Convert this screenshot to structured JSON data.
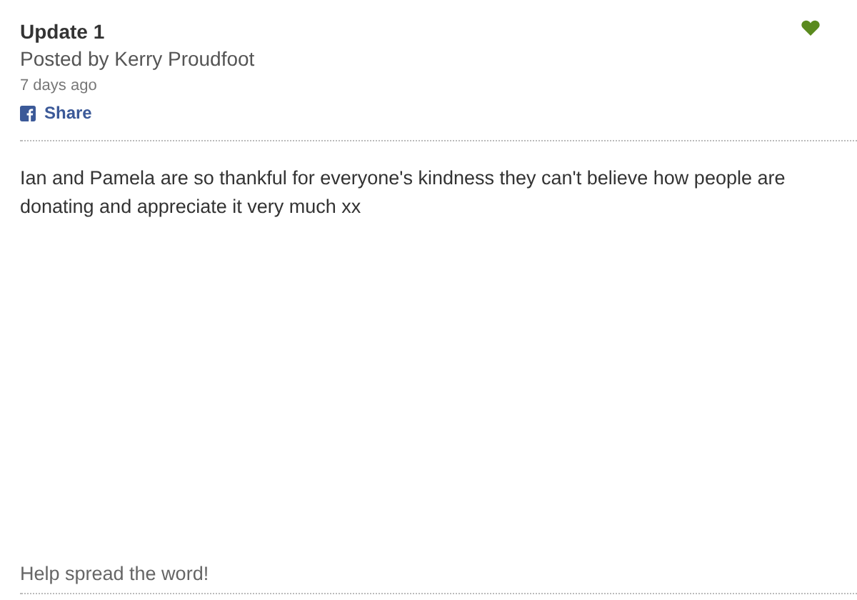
{
  "update": {
    "title": "Update 1",
    "author": "Posted by Kerry Proudfoot",
    "time": "7 days ago",
    "share": "Share",
    "body": "Ian and Pamela are so thankful for everyone's kindness they can't believe how people are donating and appreciate it very much xx"
  },
  "footer": {
    "text": "Help spread the word!"
  }
}
